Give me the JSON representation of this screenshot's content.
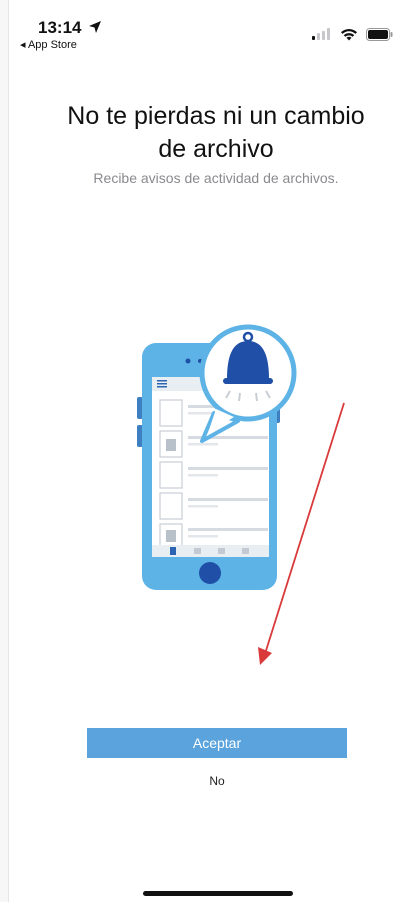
{
  "status_bar": {
    "time": "13:14",
    "back_label": "◂ App Store",
    "icons": [
      "location-arrow-icon",
      "signal-icon",
      "wifi-icon",
      "battery-icon"
    ]
  },
  "onboarding": {
    "title_line1": "No te pierdas ni un cambio",
    "title_line2": "de archivo",
    "subtitle": "Recibe avisos de actividad de archivos.",
    "illustration": "phone-with-notification-bell",
    "accept_label": "Aceptar",
    "decline_label": "No"
  },
  "colors": {
    "accent": "#5aa3dd",
    "phone_body": "#5db3e6",
    "bell": "#1f4fa6",
    "annotation_arrow": "#d93a3a"
  }
}
